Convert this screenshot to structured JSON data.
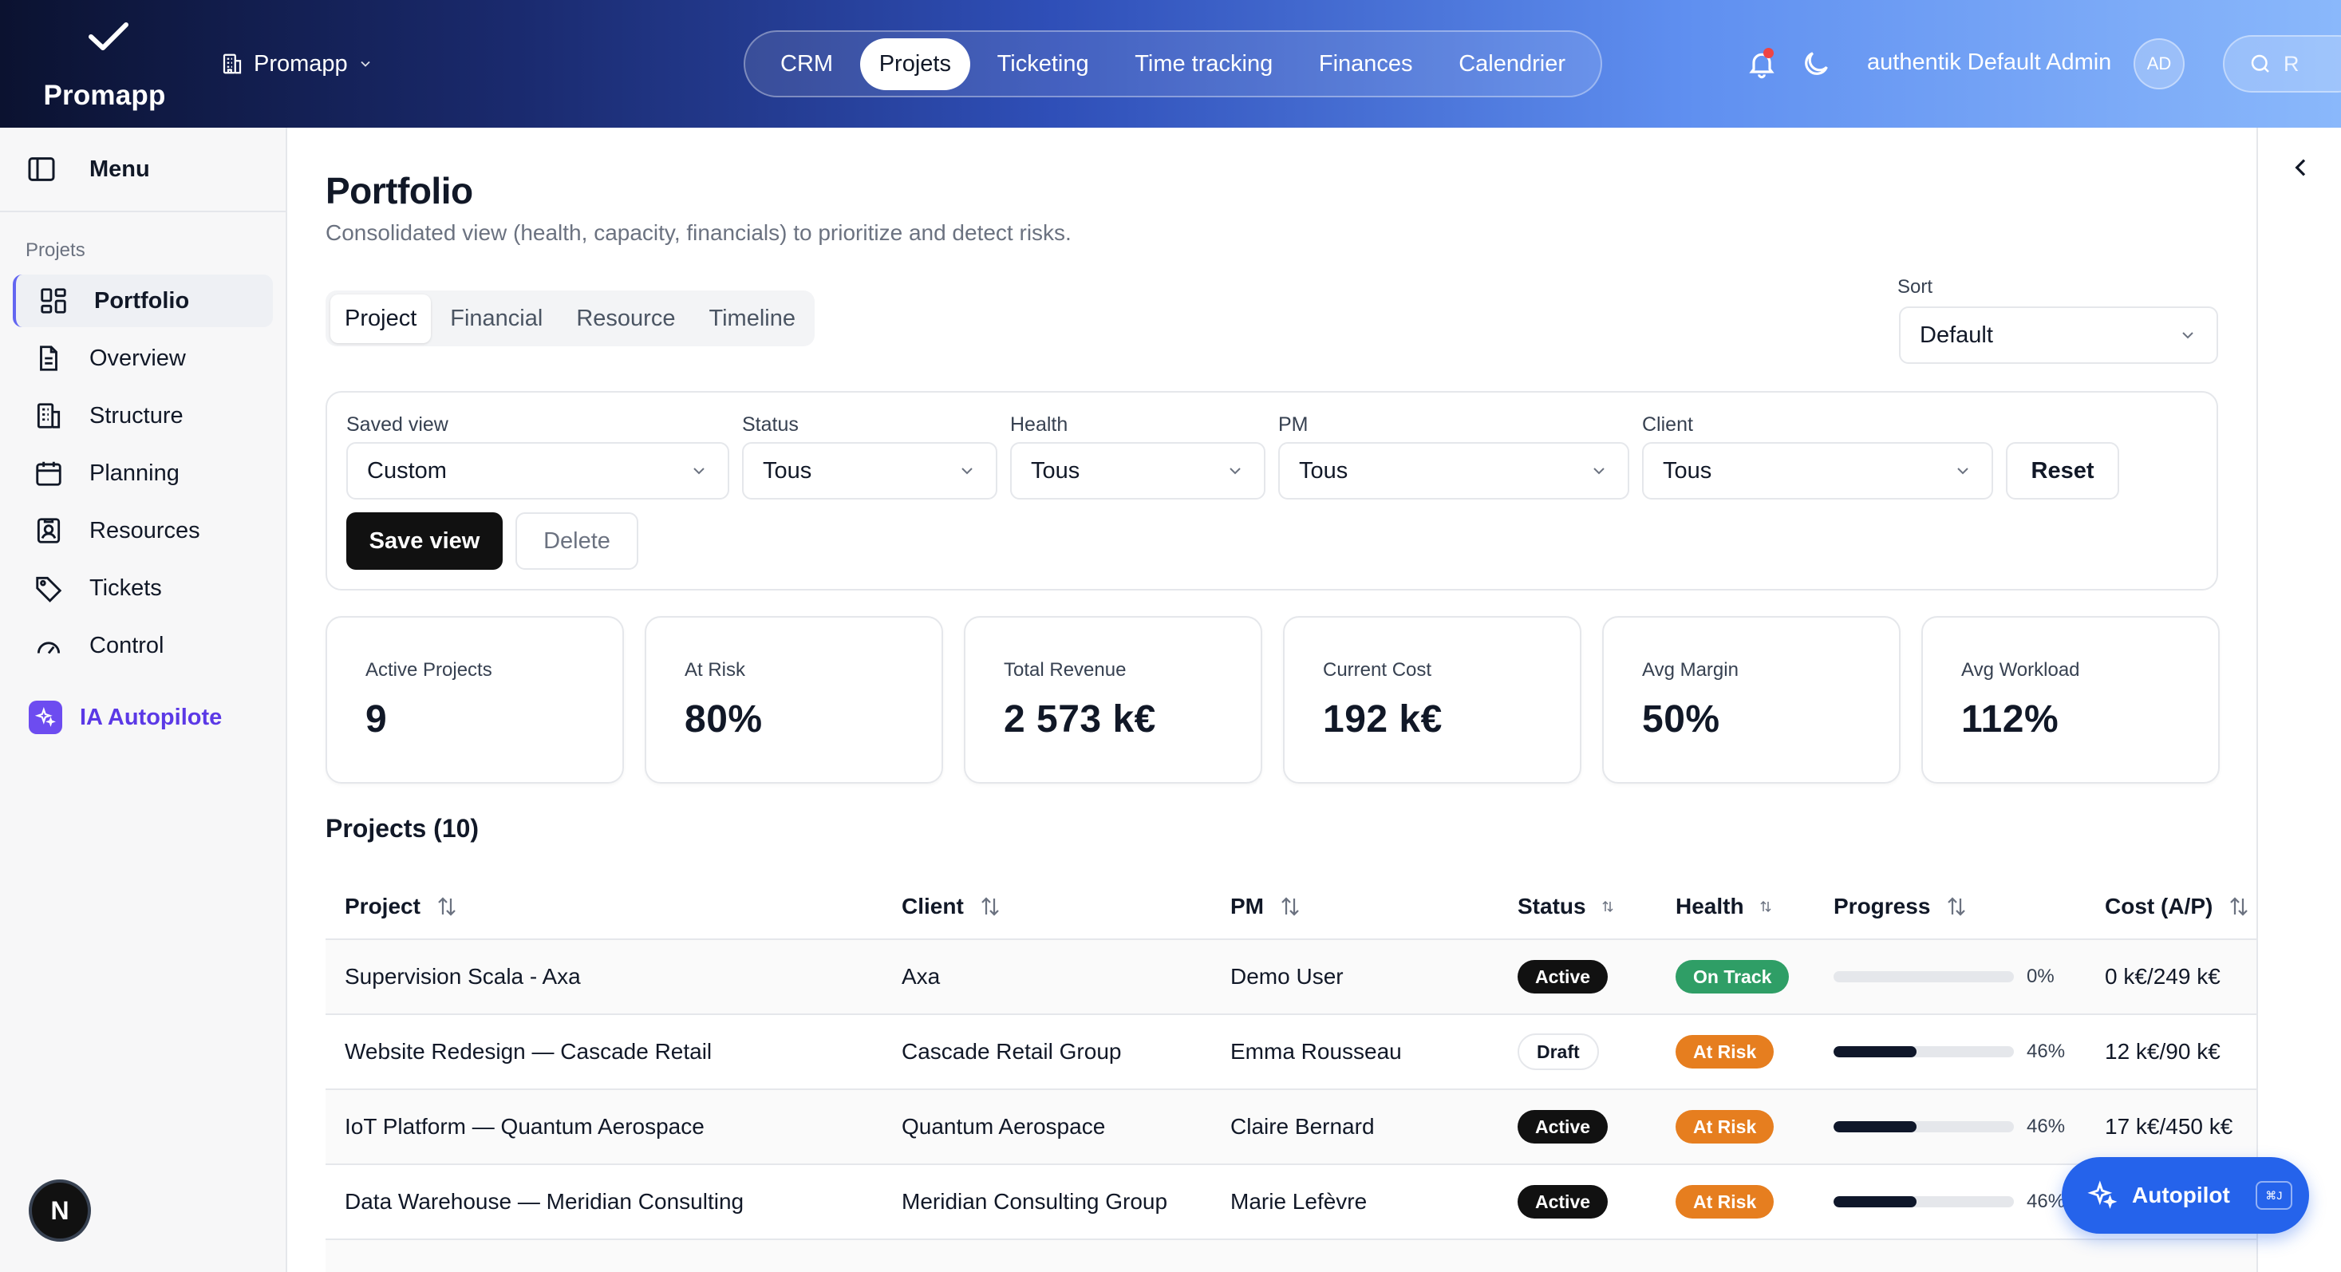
{
  "app": {
    "name": "Promapp",
    "org": "Promapp"
  },
  "topnav": {
    "items": [
      {
        "label": "CRM",
        "active": false
      },
      {
        "label": "Projets",
        "active": true
      },
      {
        "label": "Ticketing",
        "active": false
      },
      {
        "label": "Time tracking",
        "active": false
      },
      {
        "label": "Finances",
        "active": false
      },
      {
        "label": "Calendrier",
        "active": false
      }
    ],
    "user_name": "authentik Default Admin",
    "user_initials": "AD",
    "search_placeholder": "R"
  },
  "sidebar": {
    "menu_label": "Menu",
    "section": "Projets",
    "items": [
      {
        "label": "Portfolio",
        "icon": "grid-icon",
        "active": true
      },
      {
        "label": "Overview",
        "icon": "document-icon",
        "active": false
      },
      {
        "label": "Structure",
        "icon": "building-icon",
        "active": false
      },
      {
        "label": "Planning",
        "icon": "calendar-icon",
        "active": false
      },
      {
        "label": "Resources",
        "icon": "id-badge-icon",
        "active": false
      },
      {
        "label": "Tickets",
        "icon": "tag-icon",
        "active": false
      },
      {
        "label": "Control",
        "icon": "gauge-icon",
        "active": false
      }
    ],
    "ai_label": "IA Autopilote",
    "bottom_avatar": "N"
  },
  "page": {
    "title": "Portfolio",
    "subtitle": "Consolidated view (health, capacity, financials) to prioritize and detect risks.",
    "tabs": [
      {
        "label": "Project",
        "active": true
      },
      {
        "label": "Financial",
        "active": false
      },
      {
        "label": "Resource",
        "active": false
      },
      {
        "label": "Timeline",
        "active": false
      }
    ],
    "sort": {
      "label": "Sort",
      "value": "Default"
    }
  },
  "filters": {
    "saved_view": {
      "label": "Saved view",
      "value": "Custom"
    },
    "status": {
      "label": "Status",
      "value": "Tous"
    },
    "health": {
      "label": "Health",
      "value": "Tous"
    },
    "pm": {
      "label": "PM",
      "value": "Tous"
    },
    "client": {
      "label": "Client",
      "value": "Tous"
    },
    "reset_label": "Reset",
    "save_label": "Save view",
    "delete_label": "Delete"
  },
  "kpis": [
    {
      "label": "Active Projects",
      "value": "9"
    },
    {
      "label": "At Risk",
      "value": "80%"
    },
    {
      "label": "Total Revenue",
      "value": "2 573 k€"
    },
    {
      "label": "Current Cost",
      "value": "192 k€"
    },
    {
      "label": "Avg Margin",
      "value": "50%"
    },
    {
      "label": "Avg Workload",
      "value": "112%"
    }
  ],
  "projects": {
    "title": "Projects (10)",
    "columns": [
      "Project",
      "Client",
      "PM",
      "Status",
      "Health",
      "Progress",
      "Cost (A/P)"
    ],
    "rows": [
      {
        "project": "Supervision Scala - Axa",
        "client": "Axa",
        "pm": "Demo User",
        "status": "Active",
        "health": "On Track",
        "progress": 0,
        "progress_label": "0%",
        "cost": "0 k€/249 k€"
      },
      {
        "project": "Website Redesign — Cascade Retail",
        "client": "Cascade Retail Group",
        "pm": "Emma Rousseau",
        "status": "Draft",
        "health": "At Risk",
        "progress": 46,
        "progress_label": "46%",
        "cost": "12 k€/90 k€"
      },
      {
        "project": "IoT Platform — Quantum Aerospace",
        "client": "Quantum Aerospace",
        "pm": "Claire Bernard",
        "status": "Active",
        "health": "At Risk",
        "progress": 46,
        "progress_label": "46%",
        "cost": "17 k€/450 k€"
      },
      {
        "project": "Data Warehouse — Meridian Consulting",
        "client": "Meridian Consulting Group",
        "pm": "Marie Lefèvre",
        "status": "Active",
        "health": "At Risk",
        "progress": 46,
        "progress_label": "46%",
        "cost": ""
      }
    ]
  },
  "autopilot": {
    "label": "Autopilot",
    "shortcut": "⌘J"
  },
  "colors": {
    "accent": "#2563eb",
    "ai": "#6d4cf0",
    "on_track": "#2f9e66",
    "at_risk": "#e67e1f"
  }
}
